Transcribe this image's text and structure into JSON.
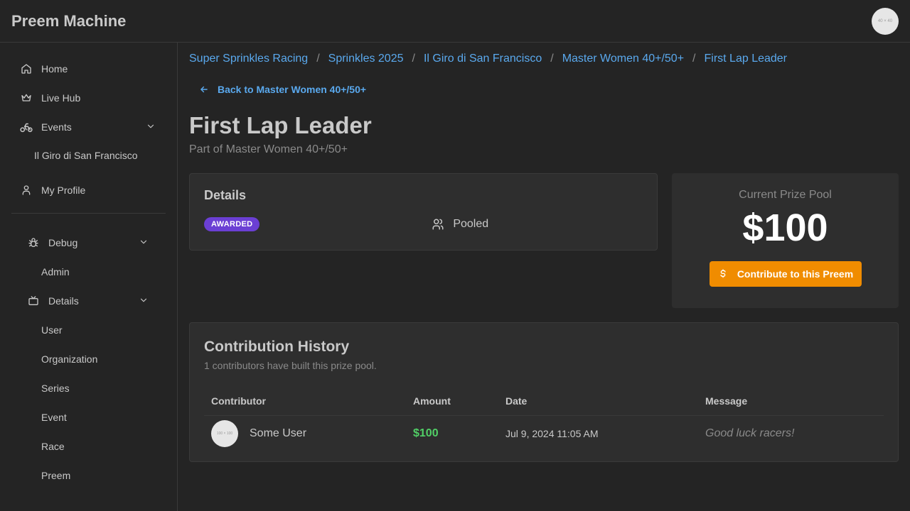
{
  "app": {
    "title": "Preem Machine",
    "avatar_placeholder": "40 × 40"
  },
  "sidebar": {
    "items": [
      {
        "label": "Home",
        "icon": "home-icon"
      },
      {
        "label": "Live Hub",
        "icon": "crown-icon"
      },
      {
        "label": "Events",
        "icon": "bike-icon",
        "expanded": true
      },
      {
        "label": "Il Giro di San Francisco"
      },
      {
        "label": "My Profile",
        "icon": "user-icon"
      }
    ],
    "debug": {
      "label": "Debug",
      "icon": "bug-icon",
      "admin": "Admin",
      "details": {
        "label": "Details",
        "icon": "tv-icon",
        "items": [
          "User",
          "Organization",
          "Series",
          "Event",
          "Race",
          "Preem"
        ]
      }
    }
  },
  "breadcrumb": [
    "Super Sprinkles Racing",
    "Sprinkles 2025",
    "Il Giro di San Francisco",
    "Master Women 40+/50+",
    "First Lap Leader"
  ],
  "back_link": "Back to Master Women 40+/50+",
  "page": {
    "title": "First Lap Leader",
    "subtitle": "Part of Master Women 40+/50+"
  },
  "details": {
    "title": "Details",
    "status_badge": "AWARDED",
    "type_label": "Pooled"
  },
  "prize": {
    "label": "Current Prize Pool",
    "amount": "$100",
    "button_label": "Contribute to this Preem"
  },
  "history": {
    "title": "Contribution History",
    "subtitle": "1 contributors have built this prize pool.",
    "columns": [
      "Contributor",
      "Amount",
      "Date",
      "Message"
    ],
    "rows": [
      {
        "avatar_placeholder": "100 × 100",
        "contributor": "Some User",
        "amount": "$100",
        "date": "Jul 9, 2024 11:05 AM",
        "message": "Good luck racers!"
      }
    ]
  },
  "colors": {
    "background": "#242424",
    "link": "#5aa9ee",
    "badge": "#6b3fd4",
    "button": "#f08c00",
    "amount": "#51cf66"
  }
}
